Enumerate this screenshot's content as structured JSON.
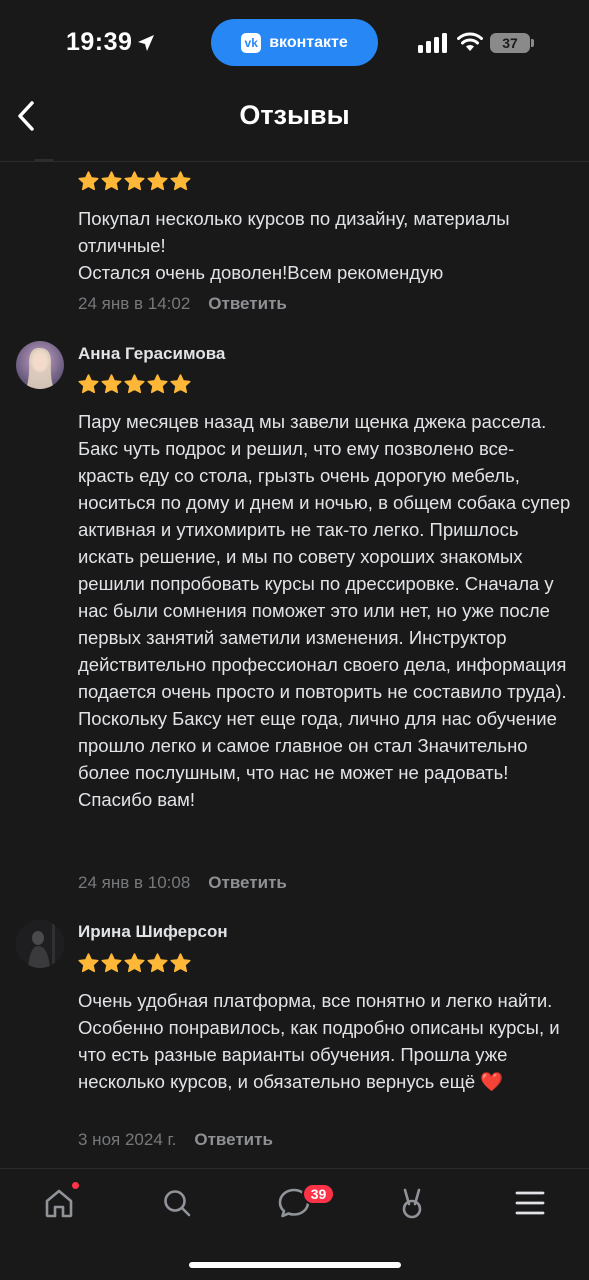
{
  "status_bar": {
    "time": "19:39",
    "app_pill": "вконтакте",
    "vk_logo": "vk",
    "battery": "37",
    "icons": [
      "location-arrow-icon",
      "signal-icon",
      "wifi-icon",
      "battery-icon"
    ]
  },
  "header": {
    "title": "Отзывы",
    "back_icon": "chevron-left-icon"
  },
  "reviews": [
    {
      "author": "",
      "rating": 5,
      "text": "Покупал несколько курсов по дизайну, материалы отличные!\nОстался очень доволен!Всем рекомендую",
      "date": "24 янв в 14:02",
      "reply": "Ответить"
    },
    {
      "author": "Анна Герасимова",
      "rating": 5,
      "text": "Пару месяцев назад мы завели щенка джека рассела. Бакс чуть подрос и решил, что ему позволено все- красть еду со стола, грызть очень дорогую мебель, носиться по дому и днем и ночью, в общем собака супер активная и утихомирить не так-то легко. Пришлось искать решение, и мы по совету хороших знакомых решили попробовать курсы по дрессировке. Сначала у нас были сомнения поможет это или нет, но уже после первых занятий заметили изменения. Инструктор действительно профессионал своего дела, информация подается очень просто и повторить не составило труда). Поскольку Баксу нет еще года, лично для нас обучение прошло легко и самое главное он стал Значительно более послушным, что нас не может не радовать! Спасибо вам!",
      "date": "24 янв в 10:08",
      "reply": "Ответить"
    },
    {
      "author": "Ирина Шиферсон",
      "rating": 5,
      "text": "Очень удобная платформа, все понятно и легко найти. Особенно понравилось, как подробно описаны курсы, и что есть разные варианты обучения. Прошла уже несколько курсов, и обязательно вернусь ещё ❤️",
      "date": "3 ноя 2024 г.",
      "reply": "Ответить"
    }
  ],
  "bottom_nav": {
    "items": [
      "home-icon",
      "search-icon",
      "messages-icon",
      "services-icon",
      "menu-icon"
    ],
    "messages_badge": "39"
  },
  "colors": {
    "background": "#19191a",
    "accent": "#2787f5",
    "star": "#ffb737",
    "badge": "#ff3347",
    "secondary_text": "#76787a"
  }
}
